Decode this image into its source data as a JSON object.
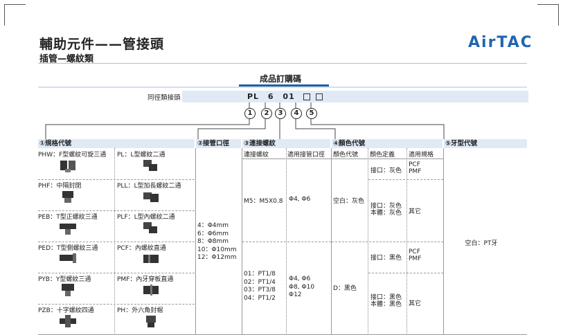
{
  "header": {
    "title": "輔助元件——管接頭",
    "subtitle": "插管—螺紋類",
    "logo": "AirTAC"
  },
  "order": {
    "title": "成品訂購碼",
    "code_label": "同徑類接頭",
    "code_parts": [
      "PL",
      "6",
      "01"
    ],
    "circle_labels": [
      "1",
      "2",
      "3",
      "4",
      "5"
    ]
  },
  "columns": {
    "c1": "①規格代號",
    "c2": "②接管口徑",
    "c3": "③連接螺紋",
    "c4": "④顏色代號",
    "c5": "⑤牙型代號"
  },
  "subheaders": {
    "thread": "連接螺紋",
    "tube": "適用接管口徑",
    "color_code": "顏色代號",
    "color_def": "顏色定義",
    "spec": "適用規格"
  },
  "specs": [
    [
      "PHW：F型螺紋可旋三通",
      "PL：L型螺紋二通"
    ],
    [
      "PHF：中隔封閉",
      "PLL：L型加長螺紋二通"
    ],
    [
      "PEB：T型正螺紋三通",
      "PLF：L型內螺紋二通"
    ],
    [
      "PED：T型側螺紋三通",
      "PCF：內螺紋直通"
    ],
    [
      "PYB：Y型螺紋三通",
      "PMF：內牙穿板直通"
    ],
    [
      "PZB：十字螺紋四通",
      "PH：外六角封帽"
    ]
  ],
  "sizes": [
    "4：Φ4mm",
    "6：Φ6mm",
    "8：Φ8mm",
    "10：Φ10mm",
    "12：Φ12mm"
  ],
  "thread_group1": {
    "thread": "M5：M5X0.8",
    "tube": "Φ4, Φ6"
  },
  "thread_group2": {
    "threads": [
      "01：PT1/8",
      "02：PT1/4",
      "03：PT3/8",
      "04：PT1/2"
    ],
    "tube": [
      "Φ4, Φ6",
      "Φ8, Φ10",
      "Φ12"
    ]
  },
  "colors": {
    "gray_code": "空白：灰色",
    "black_code": "D：黑色",
    "rows": [
      {
        "def": [
          "接口：灰色"
        ],
        "spec": [
          "PCF",
          "PMF"
        ]
      },
      {
        "def": [
          "接口：灰色",
          "本體：灰色"
        ],
        "spec": [
          "其它"
        ]
      },
      {
        "def": [
          "接口：黑色"
        ],
        "spec": [
          "PCF",
          "PMF"
        ]
      },
      {
        "def": [
          "接口：黑色",
          "本體：黑色"
        ],
        "spec": [
          "其它"
        ]
      }
    ]
  },
  "thread_type": "空白：PT牙"
}
